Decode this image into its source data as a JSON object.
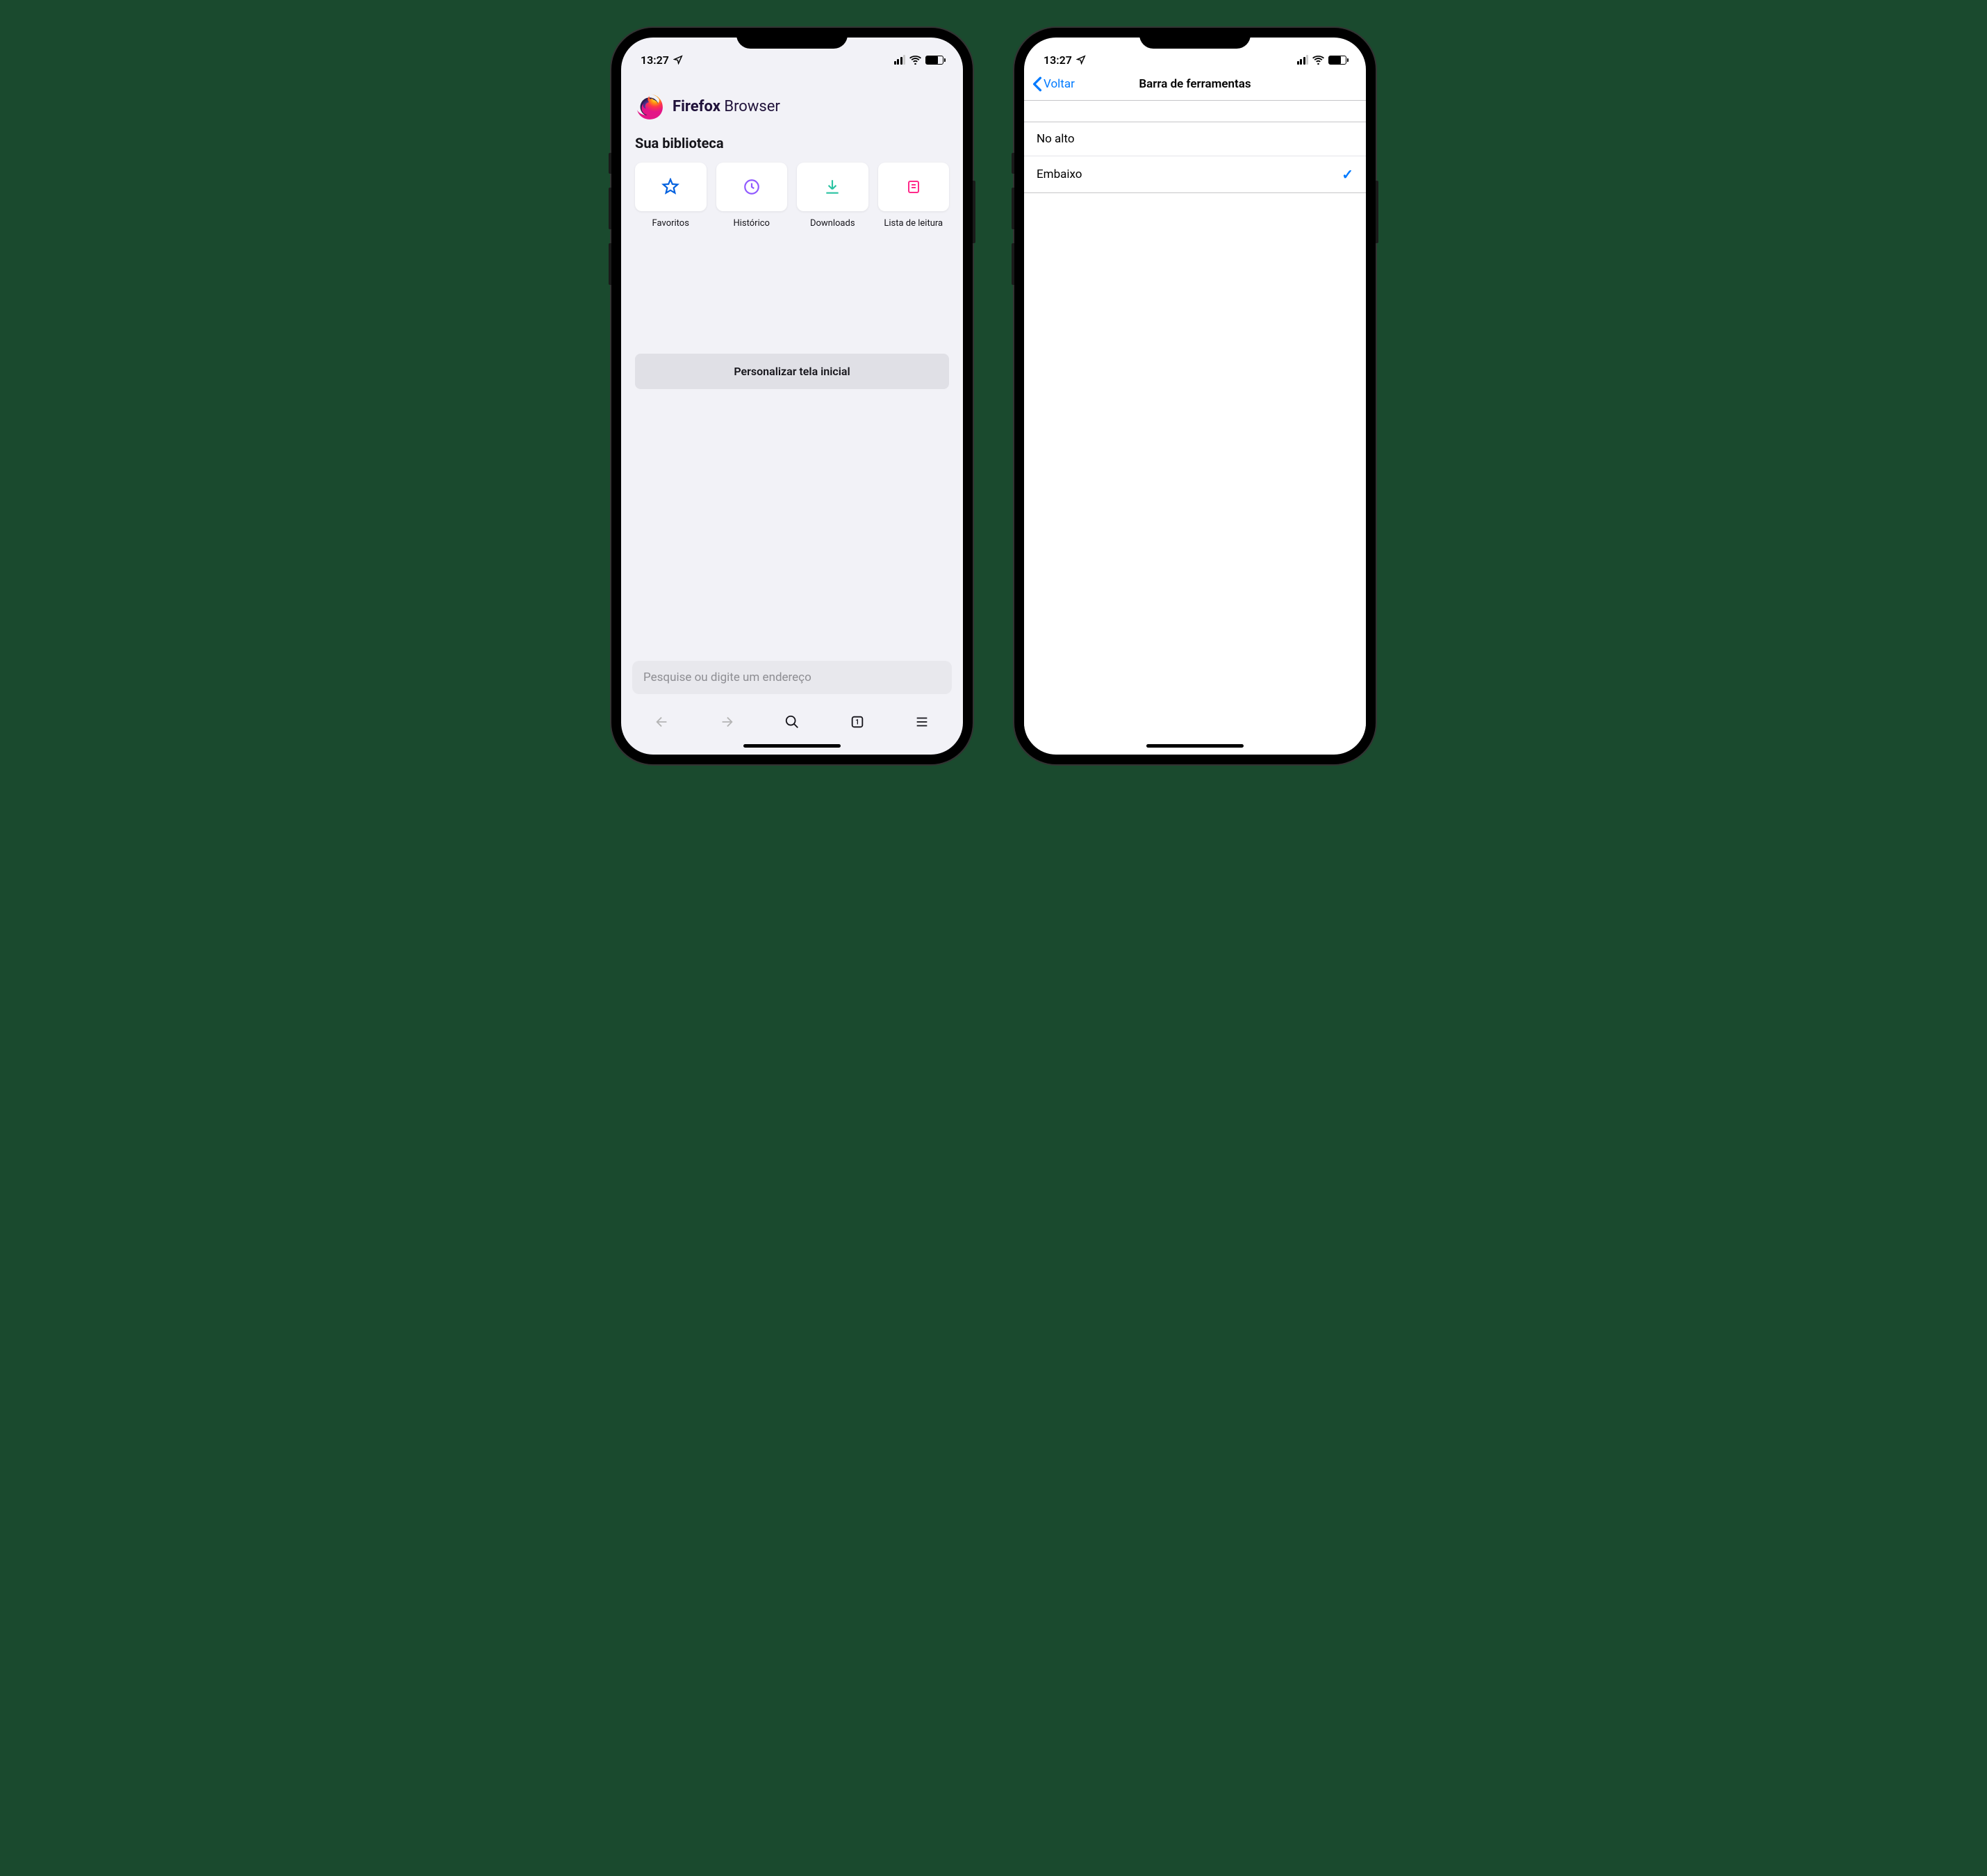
{
  "status": {
    "time": "13:27"
  },
  "phone1": {
    "app_title_bold": "Firefox",
    "app_title_light": "Browser",
    "library_heading": "Sua biblioteca",
    "library_items": [
      {
        "label": "Favoritos",
        "icon": "star"
      },
      {
        "label": "Histórico",
        "icon": "clock"
      },
      {
        "label": "Downloads",
        "icon": "download"
      },
      {
        "label": "Lista de leitura",
        "icon": "reading-list"
      }
    ],
    "customize_button": "Personalizar tela inicial",
    "search_placeholder": "Pesquise ou digite um endereço",
    "tab_count": "1"
  },
  "phone2": {
    "back_label": "Voltar",
    "header_title": "Barra de ferramentas",
    "options": [
      {
        "label": "No alto",
        "selected": false
      },
      {
        "label": "Embaixo",
        "selected": true
      }
    ]
  }
}
